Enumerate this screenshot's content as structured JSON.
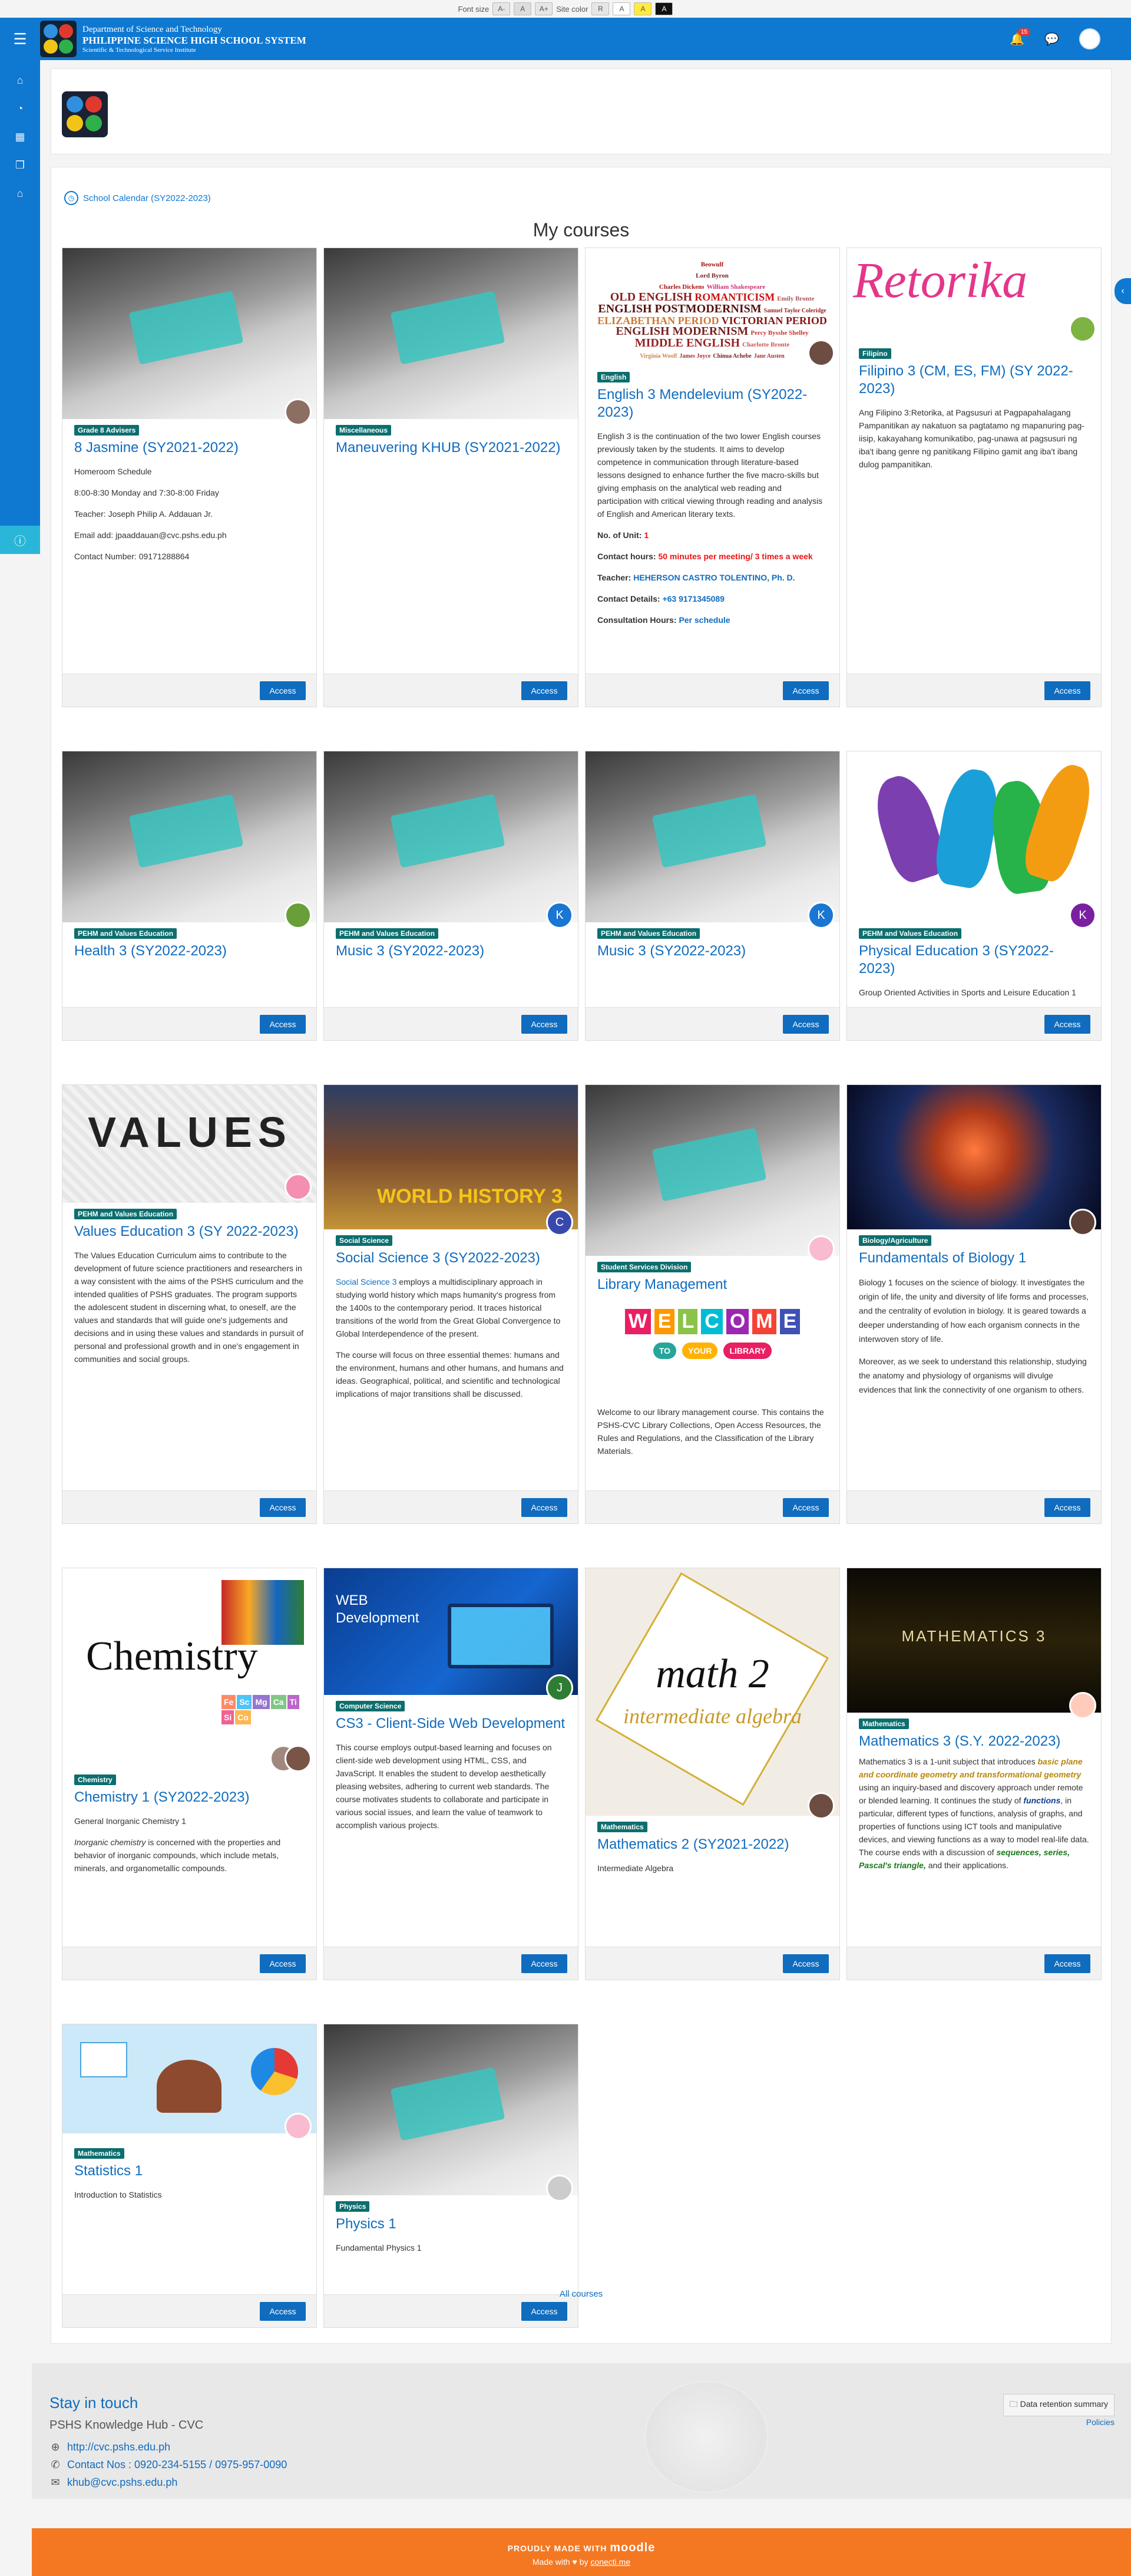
{
  "access_bar": {
    "font_size_label": "Font size",
    "font_buttons": [
      "A-",
      "A",
      "A+"
    ],
    "site_color_label": "Site color",
    "color_buttons": [
      "R",
      "A",
      "A",
      "A"
    ]
  },
  "header": {
    "line1": "Department of Science and Technology",
    "line2": "PHILIPPINE SCIENCE HIGH SCHOOL SYSTEM",
    "line3": "Scientific & Technological Service Institute",
    "notification_count": "15"
  },
  "calendar_link": "School Calendar (SY2022-2023)",
  "section_title": "My courses",
  "access_label": "Access",
  "courses": [
    {
      "category": "Grade 8 Advisers",
      "title": "8 Jasmine (SY2021-2022)",
      "lines": [
        "Homeroom Schedule",
        "8:00-8:30 Monday and 7:30-8:00 Friday",
        "Teacher: Joseph Philip A. Addauan Jr.",
        "Email add: jpaaddauan@cvc.pshs.edu.ph",
        "Contact Number: 09171288864"
      ]
    },
    {
      "category": "Miscellaneous",
      "title": "Maneuvering KHUB (SY2021-2022)"
    },
    {
      "category": "English",
      "title": "English 3 Mendelevium (SY2022-2023)",
      "paragraph": "English 3 is the continuation of the two lower English courses previously taken by the students. It aims to develop competence in communication through literature-based lessons designed to enhance further the five macro-skills but giving emphasis on the analytical web reading and participation with critical viewing through reading and analysis of English and American literary texts.",
      "units_label": "No. of Unit: ",
      "units_value": "1",
      "hours_label": "Contact hours: ",
      "hours_value": "50 minutes per meeting/ 3 times a week",
      "teacher_label": "Teacher: ",
      "teacher_value": "HEHERSON CASTRO TOLENTINO, Ph. D.",
      "details_label": "Contact Details: ",
      "details_value": "+63 9171345089",
      "consult_label": "Consultation Hours: ",
      "consult_value": "Per schedule",
      "cloud_words": [
        "Beowulf",
        "Lord Byron",
        "Charles Dickens",
        "William Shakespeare",
        "OLD ENGLISH",
        "ROMANTICISM",
        "Emily Bronte",
        "ENGLISH POSTMODERNISM",
        "Samuel Taylor Coleridge",
        "ELIZABETHAN PERIOD",
        "VICTORIAN PERIOD",
        "ENGLISH MODERNISM",
        "Percy Bysshe Shelley",
        "MIDDLE ENGLISH",
        "Charlotte Bronte",
        "Virginia Woolf",
        "James Joyce",
        "Chinua Achebe",
        "Jane Austen"
      ]
    },
    {
      "category": "Filipino",
      "title": "Filipino 3 (CM, ES, FM) (SY 2022-2023)",
      "paragraph": "Ang Filipino 3:Retorika, at Pagsusuri at Pagpapahalagang Pampanitikan ay nakatuon sa pagtatamo ng mapanuring pag-iisip, kakayahang komunikatibo, pag-unawa at pagsusuri ng iba't ibang genre ng panitikang Filipino gamit ang iba't ibang dulog pampanitikan.",
      "banner": "Retorika"
    },
    {
      "category": "PEHM and Values Education",
      "title": "Health 3 (SY2022-2023)"
    },
    {
      "category": "PEHM and Values Education",
      "title": "Music 3 (SY2022-2023)",
      "avatar_letter": "K"
    },
    {
      "category": "PEHM and Values Education",
      "title": "Music 3 (SY2022-2023)",
      "avatar_letter": "K"
    },
    {
      "category": "PEHM and Values Education",
      "title": "Physical Education 3 (SY2022-2023)",
      "paragraph": "Group Oriented Activities in Sports and Leisure Education 1",
      "avatar_letter": "K"
    },
    {
      "category": "PEHM and Values Education",
      "title": "Values Education 3 (SY 2022-2023)",
      "paragraph": "The Values Education Curriculum aims to contribute to the development of future science practitioners and researchers in a way consistent with the aims of the PSHS curriculum and the intended qualities of PSHS graduates. The program supports the adolescent student in discerning what, to oneself, are the values and standards that will guide one's judgements and decisions and in using these values and standards in pursuit of personal and professional growth and in one's engagement in communities and social groups.",
      "banner": "VALUES"
    },
    {
      "category": "Social Science",
      "title": "Social Science 3 (SY2022-2023)",
      "link": "Social Science 3",
      "paragraph": " employs a multidisciplinary approach in studying world history which maps humanity's progress from the 1400s to the contemporary period. It traces historical transitions of the world from the Great Global Convergence to Global Interdependence of the present.",
      "paragraph2": "The course will focus on three essential themes: humans and the environment, humans and other humans, and humans and ideas. Geographical, political, and scientific and technological implications of major transitions shall be discussed.",
      "banner": "WORLD HISTORY 3",
      "avatar_letter": "C"
    },
    {
      "category": "Student Services Division",
      "title": "Library Management",
      "welcome": [
        "W",
        "E",
        "L",
        "C",
        "O",
        "M",
        "E"
      ],
      "welcome_sub": [
        "TO",
        "YOUR",
        "LIBRARY"
      ],
      "paragraph": "Welcome to our library management course.  This contains the PSHS-CVC Library Collections, Open Access Resources, the Rules and Regulations, and the Classification of the Library Materials."
    },
    {
      "category": "Biology/Agriculture",
      "title": "Fundamentals of Biology 1",
      "paragraph": "Biology 1 focuses on the science of biology. It investigates the origin of life, the unity and diversity of life forms and processes, and the centrality of evolution in biology. It is geared towards a deeper understanding of how each organism connects in the interwoven story of life.",
      "paragraph2": "Moreover, as we seek to understand this relationship, studying the anatomy and physiology of organisms will divulge evidences that link the connectivity of one organism to others."
    },
    {
      "category": "Chemistry",
      "title": "Chemistry 1 (SY2022-2023)",
      "paragraph": "General Inorganic Chemistry 1",
      "em": "Inorganic chemistry",
      "paragraph2": " is concerned with the properties and behavior of inorganic compounds, which include metals, minerals, and organometallic compounds.",
      "banner": "Chemistry",
      "elements": [
        "Fe",
        "Sc",
        "Mg",
        "Ca",
        "Ti",
        "Si",
        "Co"
      ]
    },
    {
      "category": "Computer Science",
      "title": "CS3 - Client-Side Web Development",
      "paragraph": "This course employs output-based learning and focuses on client-side web development using HTML, CSS, and JavaScript. It enables the student to develop aesthetically pleasing websites, adhering to current web standards. The course motivates students to collaborate and participate in various social issues, and learn the value of teamwork to accomplish various projects.",
      "banner": "WEB Development",
      "avatar_letter": "J"
    },
    {
      "category": "Mathematics",
      "title": "Mathematics 2 (SY2021-2022)",
      "paragraph": "Intermediate Algebra",
      "banner": "math 2",
      "banner_sub": "intermediate algebra"
    },
    {
      "category": "Mathematics",
      "title": "Mathematics 3 (S.Y. 2022-2023)",
      "p_a": "Mathematics 3 is a 1-unit subject that introduces ",
      "p_em1": "basic plane and coordinate geometry and transformational geometry",
      "p_b": " using an inquiry-based and discovery approach under remote or blended learning. It continues the study of ",
      "p_em2": "functions",
      "p_c": ", in particular, different types of functions, analysis of graphs, and properties of functions using ICT tools and manipulative devices, and viewing functions as a way to model real-life data. The course ends with a discussion of ",
      "p_em3": "sequences, series, Pascal's triangle,",
      "p_d": " and their applications.",
      "banner": "MATHEMATICS 3"
    },
    {
      "category": "Mathematics",
      "title": "Statistics 1",
      "paragraph": "Introduction to Statistics"
    },
    {
      "category": "Physics",
      "title": "Physics 1",
      "paragraph": "Fundamental Physics 1"
    }
  ],
  "all_courses": "All courses",
  "footer": {
    "stay": "Stay in touch",
    "site": "PSHS Knowledge Hub - CVC",
    "url": "http://cvc.pshs.edu.ph",
    "contact": "Contact Nos : 0920-234-5155 / 0975-957-0090",
    "email": "khub@cvc.pshs.edu.ph",
    "retention": "Data retention summary",
    "policies": "Policies",
    "powered": "PROUDLY MADE WITH",
    "moodle": "moodle",
    "made_with_a": "Made with",
    "made_with_b": "by",
    "made_with_c": "conecti.me"
  },
  "colors": {
    "primary": "#0f78d1",
    "link": "#0f6cbf",
    "category": "#0d6e6e",
    "footer_bar": "#f47822"
  }
}
